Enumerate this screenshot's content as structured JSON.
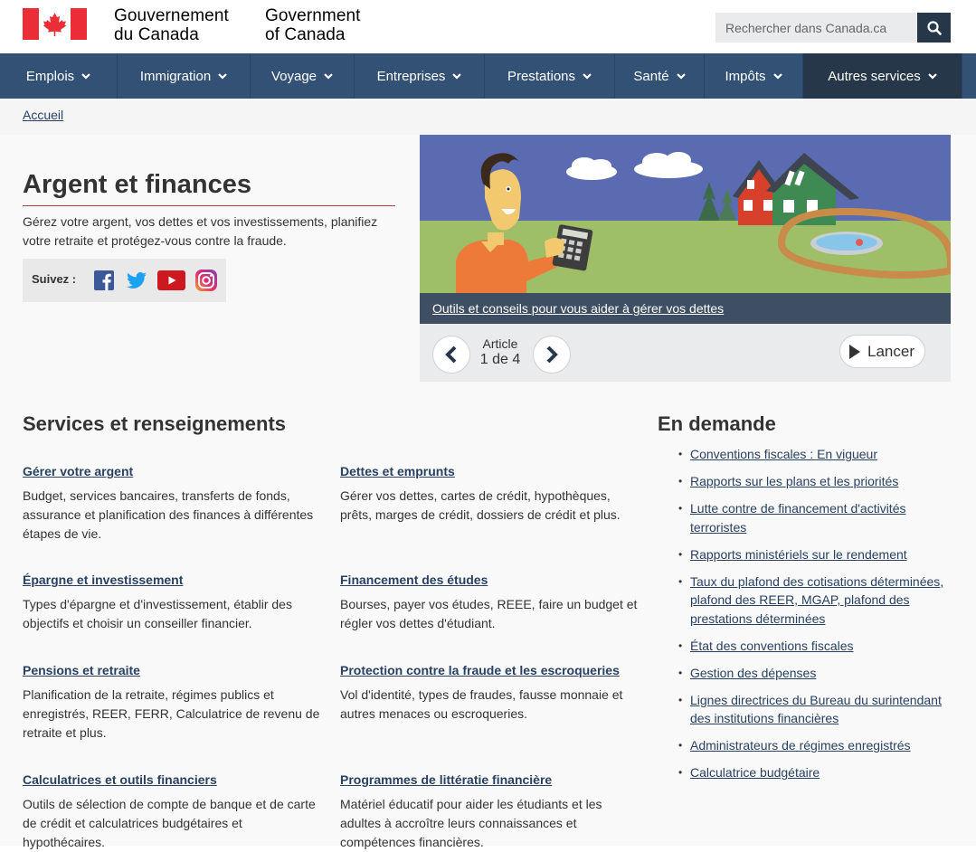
{
  "header": {
    "wordmark_fr_line1": "Gouvernement",
    "wordmark_fr_line2": "du Canada",
    "wordmark_en_line1": "Government",
    "wordmark_en_line2": "of Canada",
    "search_placeholder": "Rechercher dans Canada.ca",
    "flag_color": "#eb2d37"
  },
  "nav": {
    "items": [
      {
        "label": "Emplois"
      },
      {
        "label": "Immigration"
      },
      {
        "label": "Voyage"
      },
      {
        "label": "Entreprises"
      },
      {
        "label": "Prestations"
      },
      {
        "label": "Santé"
      },
      {
        "label": "Impôts"
      },
      {
        "label": "Autres services"
      }
    ]
  },
  "breadcrumb": {
    "home": "Accueil"
  },
  "intro": {
    "title": "Argent et finances",
    "text": "Gérez votre argent, vos dettes et vos investissements, planifiez votre retraite et protégez-vous contre la fraude.",
    "follow_label": "Suivez :"
  },
  "carousel": {
    "caption": "Outils et conseils pour vous aider à gérer vos dettes",
    "counter_label": "Article",
    "counter_value": "1 de 4",
    "launch_label": "Lancer"
  },
  "services": {
    "heading": "Services et renseignements",
    "items": [
      {
        "title": "Gérer votre argent",
        "desc": "Budget, services bancaires, transferts de fonds, assurance et planification des finances à différentes étapes de vie."
      },
      {
        "title": "Dettes et emprunts",
        "desc": "Gérer vos dettes, cartes de crédit, hypothèques, prêts, marges de crédit, dossiers de crédit et plus."
      },
      {
        "title": "Épargne et investissement",
        "desc": "Types d'épargne et d'investissement, établir des objectifs et choisir un conseiller financier."
      },
      {
        "title": "Financement des études",
        "desc": "Bourses, payer vos études, REEE, faire un budget et régler vos dettes d'étudiant."
      },
      {
        "title": "Pensions et retraite",
        "desc": "Planification de la retraite, régimes publics et enregistrés, REER, FERR, Calculatrice de revenu de retraite et plus."
      },
      {
        "title": "Protection contre la fraude et les escroqueries",
        "desc": "Vol d'identité, types de fraudes, fausse monnaie et autres menaces ou escroqueries."
      },
      {
        "title": "Calculatrices et outils financiers",
        "desc": "Outils de sélection de compte de banque et de carte de crédit et calculatrices budgétaires et hypothécaires."
      },
      {
        "title": "Programmes de littératie financière",
        "desc": "Matériel éducatif pour aider les étudiants et les adultes à accroître leurs connaissances et compétences financières."
      }
    ]
  },
  "demand": {
    "heading": "En demande",
    "items": [
      {
        "label": "Conventions fiscales : En vigueur"
      },
      {
        "label": "Rapports sur les plans et les priorités"
      },
      {
        "label": "Lutte contre de financement d'activités terroristes"
      },
      {
        "label": "Rapports ministériels sur le rendement"
      },
      {
        "label": "Taux du plafond des cotisations déterminées, plafond des REER, MGAP, plafond des prestations déterminées"
      },
      {
        "label": "État des conventions fiscales"
      },
      {
        "label": "Gestion des dépenses"
      },
      {
        "label": "Lignes directrices du Bureau du surintendant des institutions financières"
      },
      {
        "label": "Administrateurs de régimes enregistrés"
      },
      {
        "label": "Calculatrice budgétaire"
      }
    ]
  }
}
